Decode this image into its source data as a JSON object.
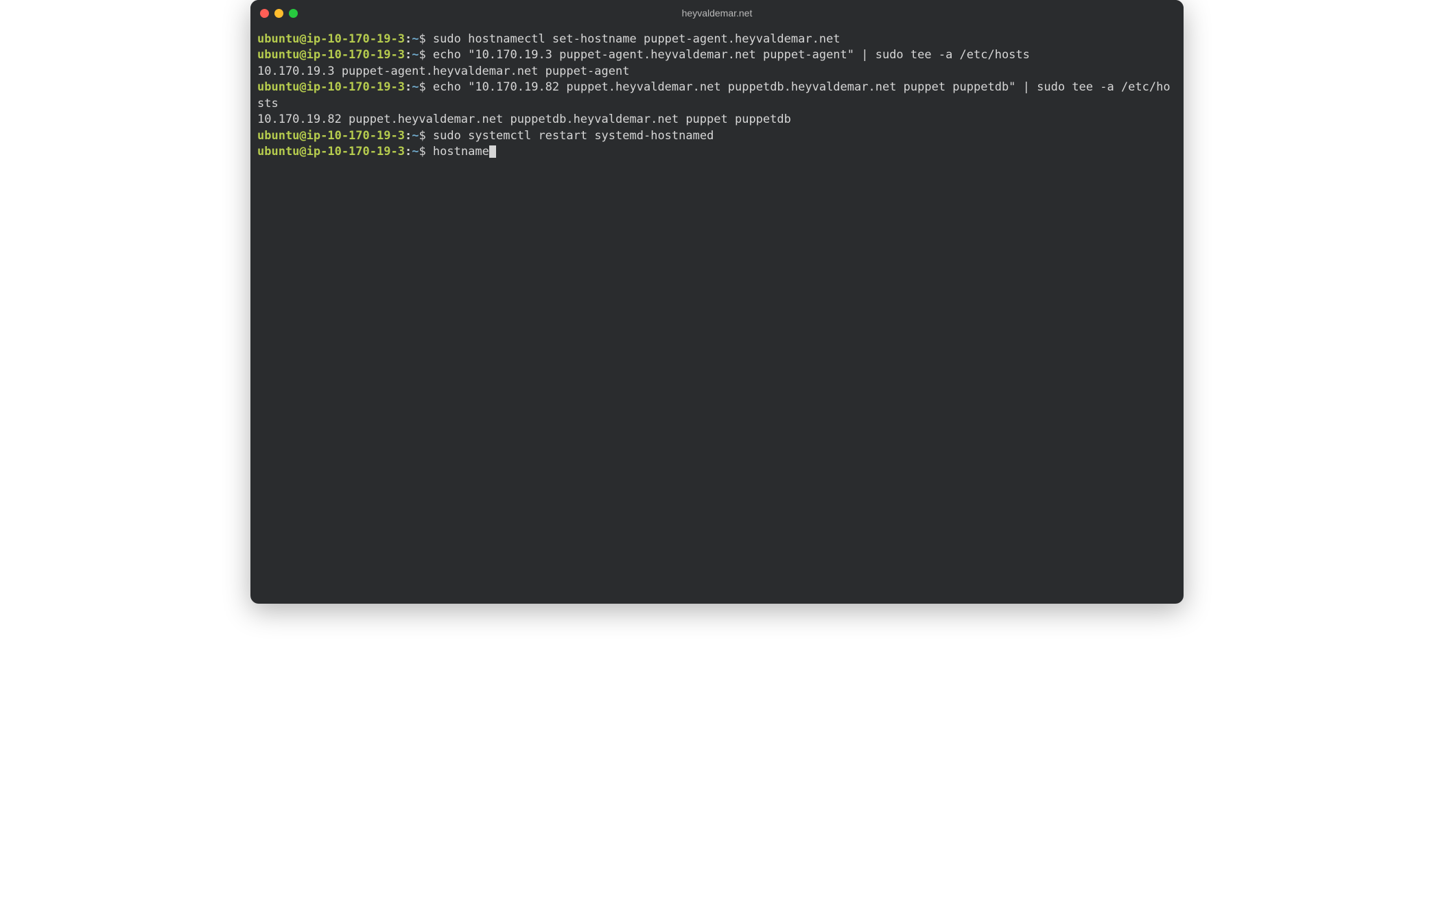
{
  "window": {
    "title": "heyvaldemar.net"
  },
  "prompt": {
    "user_host": "ubuntu@ip-10-170-19-3",
    "sep": ":",
    "path": "~",
    "symbol": "$"
  },
  "lines": [
    {
      "type": "cmd",
      "command": "sudo hostnamectl set-hostname puppet-agent.heyvaldemar.net"
    },
    {
      "type": "cmd",
      "command": "echo \"10.170.19.3 puppet-agent.heyvaldemar.net puppet-agent\" | sudo tee -a /etc/hosts"
    },
    {
      "type": "out",
      "text": "10.170.19.3 puppet-agent.heyvaldemar.net puppet-agent"
    },
    {
      "type": "cmd",
      "command": "echo \"10.170.19.82 puppet.heyvaldemar.net puppetdb.heyvaldemar.net puppet puppetdb\" | sudo tee -a /etc/hosts"
    },
    {
      "type": "out",
      "text": "10.170.19.82 puppet.heyvaldemar.net puppetdb.heyvaldemar.net puppet puppetdb"
    },
    {
      "type": "cmd",
      "command": "sudo systemctl restart systemd-hostnamed"
    },
    {
      "type": "cmd",
      "command": "hostname",
      "cursor": true
    }
  ]
}
